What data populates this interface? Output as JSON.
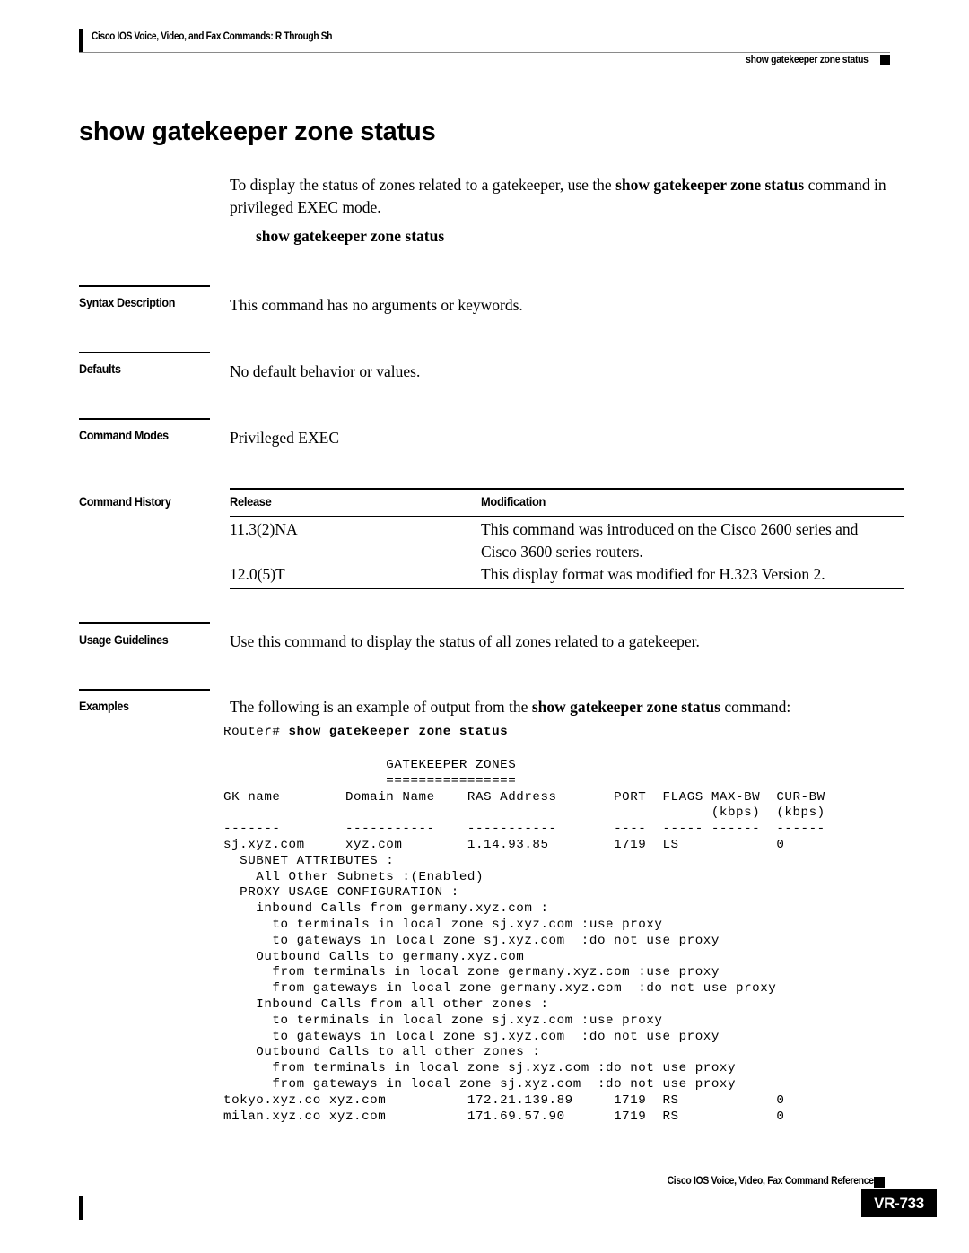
{
  "header": {
    "left_title": "Cisco IOS Voice, Video, and Fax Commands: R Through Sh",
    "right_title": "show gatekeeper zone status"
  },
  "command": {
    "title": "show gatekeeper zone status",
    "intro_prefix": "To display the status of zones related to a gatekeeper, use the ",
    "intro_bold": "show gatekeeper zone status",
    "intro_suffix": " command in privileged EXEC mode.",
    "syntax_line": "show gatekeeper zone status"
  },
  "sections": {
    "syntax_description": {
      "label": "Syntax Description",
      "text": "This command has no arguments or keywords."
    },
    "defaults": {
      "label": "Defaults",
      "text": "No default behavior or values."
    },
    "command_modes": {
      "label": "Command Modes",
      "text": "Privileged EXEC"
    },
    "command_history": {
      "label": "Command History",
      "columns": [
        "Release",
        "Modification"
      ],
      "rows": [
        {
          "release": "11.3(2)NA",
          "modification_line1": "This command was introduced on the Cisco 2600 series and",
          "modification_line2": "Cisco 3600 series routers."
        },
        {
          "release": "12.0(5)T",
          "modification_line1": "This display format was modified for H.323 Version 2.",
          "modification_line2": ""
        }
      ]
    },
    "usage_guidelines": {
      "label": "Usage Guidelines",
      "text": "Use this command to display the status of all zones related to a gatekeeper."
    },
    "examples": {
      "label": "Examples",
      "intro_prefix": "The following is an example of output from the ",
      "intro_bold": "show gatekeeper zone status",
      "intro_suffix": " command:",
      "prompt": "Router# ",
      "prompt_command": "show gatekeeper zone status",
      "output_lines": [
        "                    GATEKEEPER ZONES",
        "                    ================",
        "GK name        Domain Name    RAS Address       PORT  FLAGS MAX-BW  CUR-BW",
        "                                                            (kbps)  (kbps)",
        "-------        -----------    -----------       ----  ----- ------  ------",
        "sj.xyz.com     xyz.com        1.14.93.85        1719  LS            0",
        "  SUBNET ATTRIBUTES :",
        "    All Other Subnets :(Enabled)",
        "  PROXY USAGE CONFIGURATION :",
        "    inbound Calls from germany.xyz.com :",
        "      to terminals in local zone sj.xyz.com :use proxy",
        "      to gateways in local zone sj.xyz.com  :do not use proxy",
        "    Outbound Calls to germany.xyz.com",
        "      from terminals in local zone germany.xyz.com :use proxy",
        "      from gateways in local zone germany.xyz.com  :do not use proxy",
        "    Inbound Calls from all other zones :",
        "      to terminals in local zone sj.xyz.com :use proxy",
        "      to gateways in local zone sj.xyz.com  :do not use proxy",
        "    Outbound Calls to all other zones :",
        "      from terminals in local zone sj.xyz.com :do not use proxy",
        "      from gateways in local zone sj.xyz.com  :do not use proxy",
        "tokyo.xyz.co xyz.com          172.21.139.89     1719  RS            0",
        "milan.xyz.co xyz.com          171.69.57.90      1719  RS            0"
      ]
    }
  },
  "footer": {
    "reference": "Cisco IOS Voice, Video, Fax Command Reference",
    "page_number": "VR-733"
  }
}
